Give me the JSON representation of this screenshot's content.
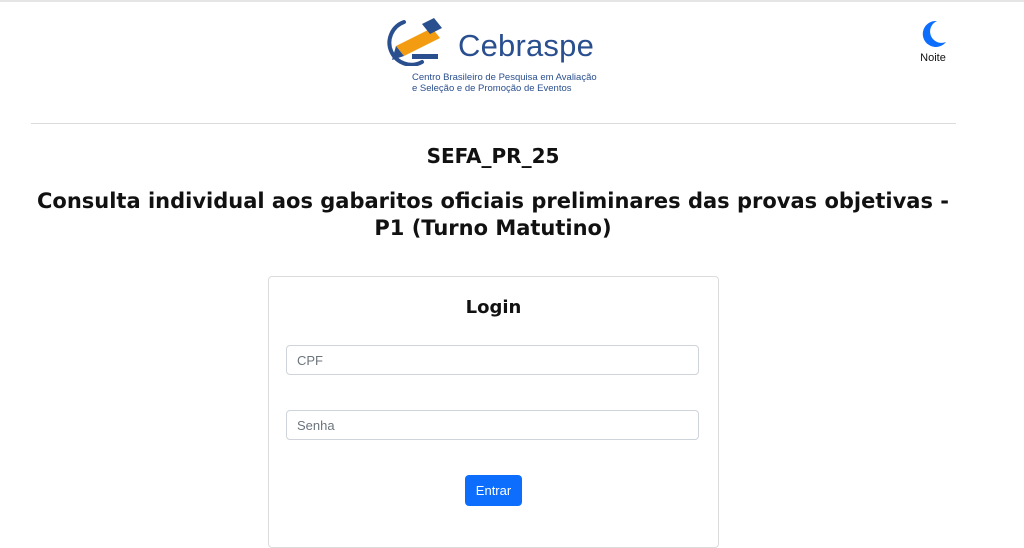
{
  "header": {
    "brand_name": "Cebraspe",
    "brand_subtitle_line1": "Centro Brasileiro de Pesquisa em Avaliação",
    "brand_subtitle_line2": "e Seleção e de Promoção de Eventos",
    "theme_toggle_label": "Noite",
    "theme_icon": "moon-icon"
  },
  "main": {
    "exam_code": "SEFA_PR_25",
    "title": "Consulta individual aos gabaritos oficiais preliminares das provas objetivas - P1 (Turno Matutino)"
  },
  "login": {
    "heading": "Login",
    "cpf_placeholder": "CPF",
    "cpf_value": "",
    "senha_placeholder": "Senha",
    "senha_value": "",
    "submit_label": "Entrar"
  },
  "colors": {
    "brand_blue": "#2a4f8f",
    "brand_orange": "#f39c12",
    "accent": "#0d6efd"
  }
}
